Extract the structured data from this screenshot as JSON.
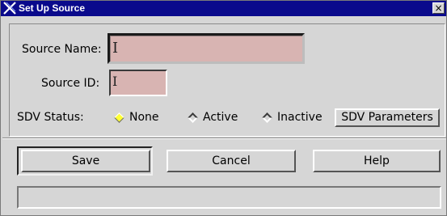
{
  "window": {
    "title": "Set Up Source",
    "close_glyph": "×"
  },
  "form": {
    "source_name_label": "Source Name:",
    "source_name_value": "",
    "source_id_label": "Source ID:",
    "source_id_value": "",
    "sdv_status_label": "SDV Status:",
    "sdv_options": [
      {
        "label": "None",
        "selected": true
      },
      {
        "label": "Active",
        "selected": false
      },
      {
        "label": "Inactive",
        "selected": false
      }
    ],
    "sdv_parameters_label": "SDV Parameters"
  },
  "actions": {
    "save_label": "Save",
    "cancel_label": "Cancel",
    "help_label": "Help"
  },
  "status_bar": {
    "text": ""
  },
  "colors": {
    "titlebar": "#0a0a8c",
    "window_bg": "#d6d6d6",
    "field_bg": "#d8b4b2",
    "radio_selected": "#ffff33"
  },
  "icons": {
    "title": "motif-x-icon",
    "close": "close-icon",
    "caret": "text-cursor-icon"
  }
}
